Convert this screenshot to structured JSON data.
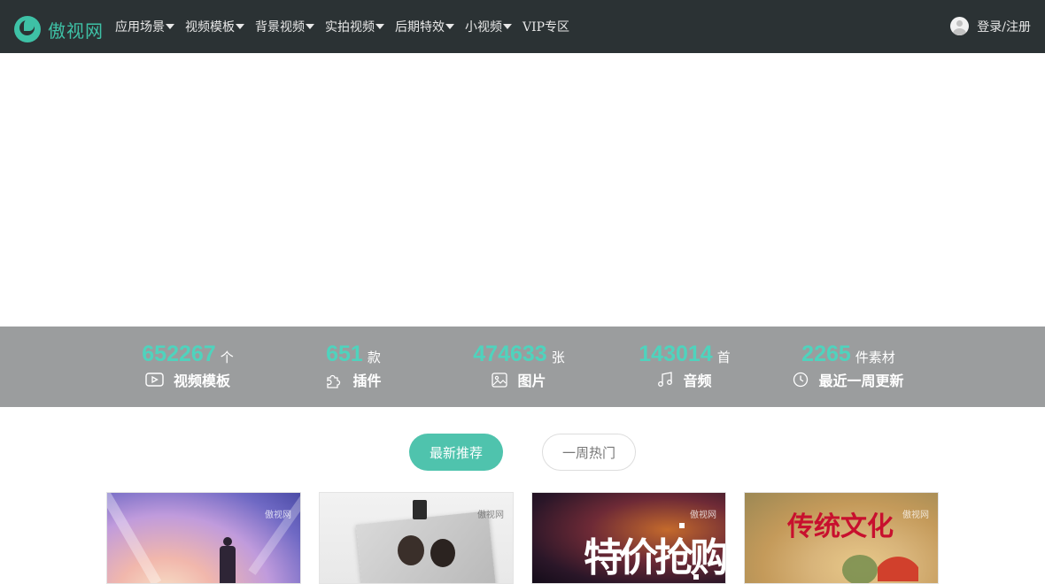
{
  "header": {
    "logo_text": "傲视网",
    "nav": [
      {
        "label": "应用场景",
        "has_dropdown": true
      },
      {
        "label": "视频模板",
        "has_dropdown": true
      },
      {
        "label": "背景视频",
        "has_dropdown": true
      },
      {
        "label": "实拍视频",
        "has_dropdown": true
      },
      {
        "label": "后期特效",
        "has_dropdown": true
      },
      {
        "label": "小视频",
        "has_dropdown": true
      },
      {
        "label": "VIP专区",
        "has_dropdown": false
      }
    ],
    "login_label": "登录/注册"
  },
  "stats": [
    {
      "number": "652267",
      "unit": "个",
      "label": "视频模板",
      "icon": "video-icon"
    },
    {
      "number": "651",
      "unit": "款",
      "label": "插件",
      "icon": "puzzle-icon"
    },
    {
      "number": "474633",
      "unit": "张",
      "label": "图片",
      "icon": "image-icon"
    },
    {
      "number": "143014",
      "unit": "首",
      "label": "音频",
      "icon": "music-icon"
    },
    {
      "number": "2265",
      "unit": "件素材",
      "label": "最近一周更新",
      "icon": "clock-icon"
    }
  ],
  "tabs": {
    "active": "最新推荐",
    "inactive": "一周热门"
  },
  "cards": [
    {
      "thumbnail": "runner-sunset-thumbnail",
      "watermark": "傲视网"
    },
    {
      "thumbnail": "couple-photo-thumbnail",
      "watermark": "傲视网"
    },
    {
      "thumbnail": "promo-text-thumbnail",
      "watermark": "傲视网",
      "overlay_text": "特价抢购"
    },
    {
      "thumbnail": "traditional-culture-thumbnail",
      "watermark": "傲视网",
      "overlay_text": "传统文化"
    }
  ],
  "colors": {
    "header_bg": "#2b3234",
    "accent": "#4fc3ad",
    "stats_bg": "#9b9d9e",
    "stat_number": "#4fd3bd"
  }
}
